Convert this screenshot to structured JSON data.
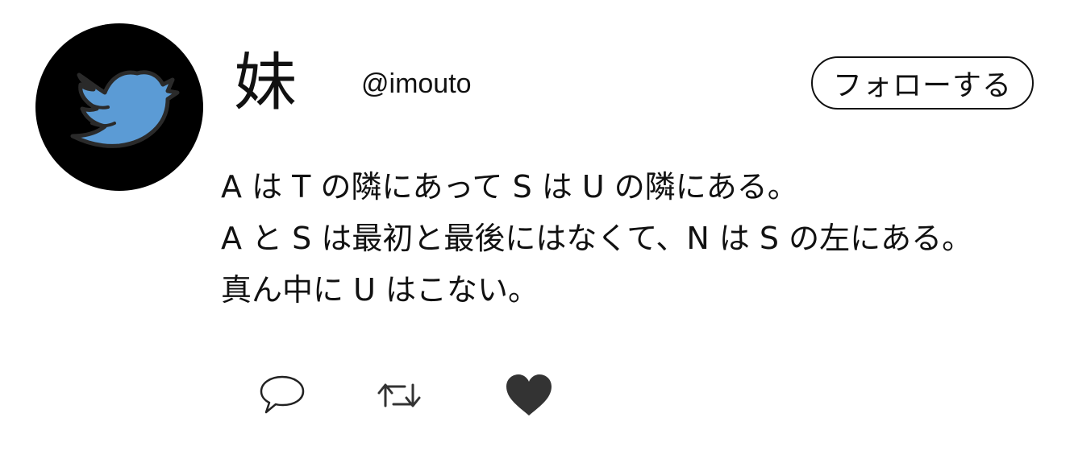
{
  "profile": {
    "display_name": "妹",
    "handle": "@imouto",
    "avatar_icon": "bird-icon",
    "avatar_colors": {
      "background": "#000000",
      "bird": "#5b9bd5"
    }
  },
  "follow": {
    "label": "フォローする"
  },
  "tweet": {
    "lines": [
      "A は T の隣にあって S は U の隣にある。",
      "A と S は最初と最後にはなくて、N は S の左にある。",
      "真ん中に U はこない。"
    ]
  },
  "actions": {
    "reply_icon": "speech-bubble-icon",
    "retweet_icon": "retweet-icon",
    "like_icon": "heart-icon",
    "like_color": "#333333"
  }
}
